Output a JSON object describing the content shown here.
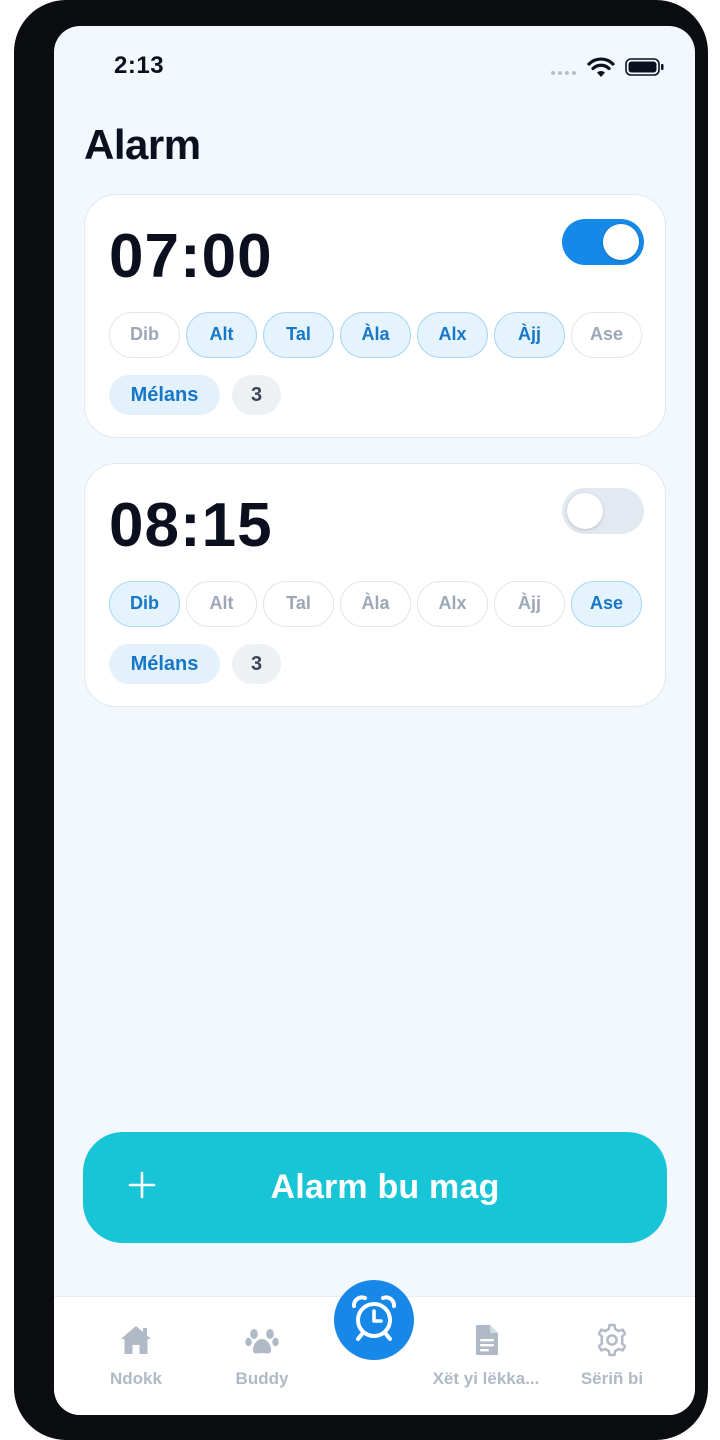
{
  "status_bar": {
    "time": "2:13"
  },
  "page": {
    "title": "Alarm"
  },
  "alarms": [
    {
      "time": "07:00",
      "enabled": true,
      "days": [
        {
          "label": "Dib",
          "active": false
        },
        {
          "label": "Alt",
          "active": true
        },
        {
          "label": "Tal",
          "active": true
        },
        {
          "label": "Àla",
          "active": true
        },
        {
          "label": "Alx",
          "active": true
        },
        {
          "label": "Àjj",
          "active": true
        },
        {
          "label": "Ase",
          "active": false
        }
      ],
      "tag": "Mélans",
      "count": "3"
    },
    {
      "time": "08:15",
      "enabled": false,
      "days": [
        {
          "label": "Dib",
          "active": true
        },
        {
          "label": "Alt",
          "active": false
        },
        {
          "label": "Tal",
          "active": false
        },
        {
          "label": "Àla",
          "active": false
        },
        {
          "label": "Alx",
          "active": false
        },
        {
          "label": "Àjj",
          "active": false
        },
        {
          "label": "Ase",
          "active": true
        }
      ],
      "tag": "Mélans",
      "count": "3"
    }
  ],
  "add_button": {
    "label": "Alarm bu mag",
    "icon": "plus-icon"
  },
  "tab_bar": {
    "items": [
      {
        "label": "Ndokk",
        "icon": "home-icon"
      },
      {
        "label": "Buddy",
        "icon": "paw-icon"
      },
      {
        "label": "",
        "icon": "alarm-clock-icon",
        "active": true
      },
      {
        "label": "Xët yi lëkka...",
        "icon": "document-icon"
      },
      {
        "label": "Sëriñ bi",
        "icon": "gear-icon"
      }
    ]
  },
  "colors": {
    "accent": "#1688e8",
    "add_button": "#17c5d6",
    "background": "#f2f8fd",
    "active_chip_text": "#1677c7"
  }
}
